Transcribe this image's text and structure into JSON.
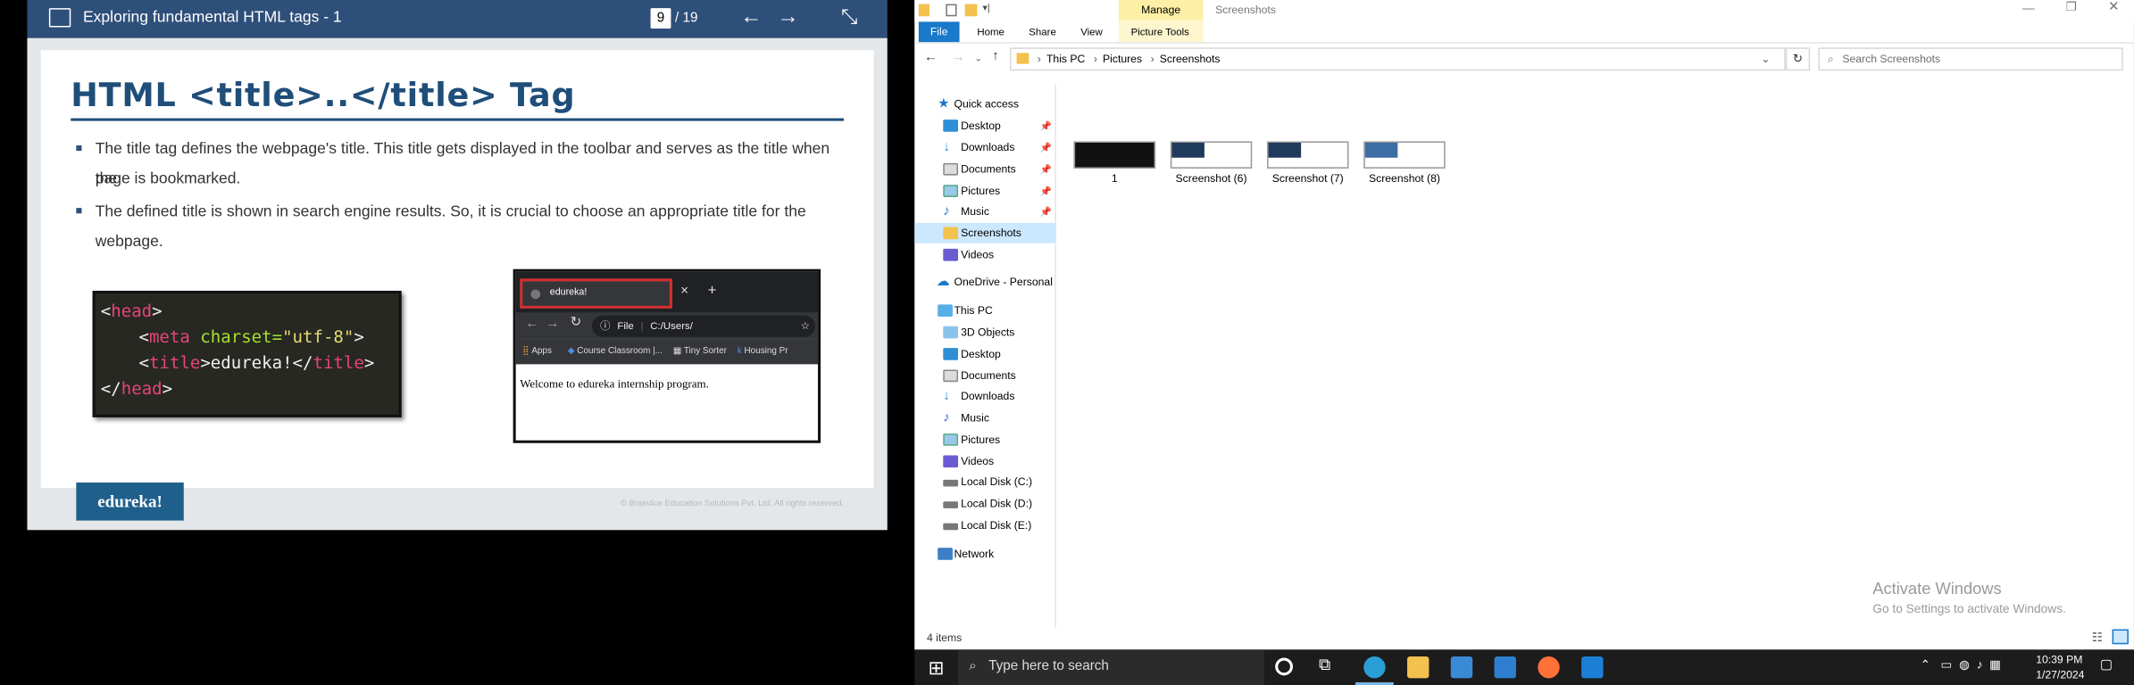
{
  "presentation": {
    "title": "Exploring fundamental HTML tags - 1",
    "current_page": "9",
    "page_total": "/ 19"
  },
  "slide": {
    "heading": "HTML <title>..</title> Tag",
    "bullets": [
      "The title tag defines the webpage's title. This title gets displayed in the toolbar and serves as the title when the",
      "page is bookmarked.",
      "The defined title is shown in search engine results. So, it is crucial to choose an appropriate title for the",
      "webpage."
    ],
    "code": {
      "l1a": "<",
      "l1b": "head",
      "l1c": ">",
      "l2a": "<",
      "l2b": "meta",
      "l2c": " charset=",
      "l2d": "\"utf-8\"",
      "l2e": ">",
      "l3a": "<",
      "l3b": "title",
      "l3c": ">edureka!</",
      "l3d": "title",
      "l3e": ">",
      "l4a": "</",
      "l4b": "head",
      "l4c": ">"
    },
    "browser": {
      "tab_title": "edureka!",
      "close": "×",
      "new_tab": "+",
      "file_label": "File",
      "address": "C:/Users/",
      "bookmarks": [
        "Apps",
        "Course Classroom |...",
        "Tiny Sorter",
        "Housing Pr"
      ],
      "page_text": "Welcome to edureka internship program."
    },
    "brand": "edureka!",
    "copyright": "© Brain4ce Education Solutions Pvt. Ltd. All rights reserved."
  },
  "explorer": {
    "manage_label": "Manage",
    "window_title": "Screenshots",
    "ribbon_tabs": [
      "File",
      "Home",
      "Share",
      "View",
      "Picture Tools"
    ],
    "breadcrumb": [
      "This PC",
      "Pictures",
      "Screenshots"
    ],
    "search_placeholder": "Search Screenshots",
    "nav": {
      "quick_access": "Quick access",
      "qa_items": [
        "Desktop",
        "Downloads",
        "Documents",
        "Pictures",
        "Music",
        "Screenshots",
        "Videos"
      ],
      "onedrive": "OneDrive - Personal",
      "this_pc": "This PC",
      "pc_items": [
        "3D Objects",
        "Desktop",
        "Documents",
        "Downloads",
        "Music",
        "Pictures",
        "Videos",
        "Local Disk (C:)",
        "Local Disk (D:)",
        "Local Disk (E:)"
      ],
      "network": "Network"
    },
    "files": [
      "1",
      "Screenshot (6)",
      "Screenshot (7)",
      "Screenshot (8)"
    ],
    "status": "4 items",
    "watermark_title": "Activate Windows",
    "watermark_sub": "Go to Settings to activate Windows."
  },
  "taskbar": {
    "search_placeholder": "Type here to search",
    "time": "10:39 PM",
    "date": "1/27/2024"
  }
}
